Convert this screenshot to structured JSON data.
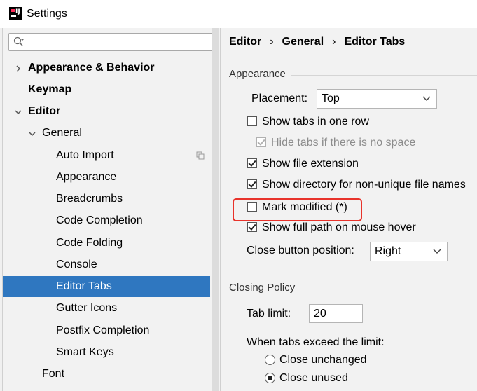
{
  "window": {
    "title": "Settings"
  },
  "search": {
    "placeholder": ""
  },
  "tree": [
    {
      "label": "Appearance & Behavior",
      "bold": true,
      "arrow": "right",
      "selected": false,
      "name": "tree-item-appearance-behavior"
    },
    {
      "label": "Keymap",
      "bold": true,
      "arrow": "",
      "selected": false,
      "name": "tree-item-keymap"
    },
    {
      "label": "Editor",
      "bold": true,
      "arrow": "down",
      "selected": false,
      "name": "tree-item-editor"
    },
    {
      "label": "General",
      "bold": false,
      "arrow": "down",
      "selected": false,
      "name": "tree-item-general"
    },
    {
      "label": "Auto Import",
      "bold": false,
      "arrow": "",
      "selected": false,
      "icon": "copy-icon",
      "name": "tree-item-auto-import"
    },
    {
      "label": "Appearance",
      "bold": false,
      "arrow": "",
      "selected": false,
      "name": "tree-item-appearance"
    },
    {
      "label": "Breadcrumbs",
      "bold": false,
      "arrow": "",
      "selected": false,
      "name": "tree-item-breadcrumbs"
    },
    {
      "label": "Code Completion",
      "bold": false,
      "arrow": "",
      "selected": false,
      "name": "tree-item-code-completion"
    },
    {
      "label": "Code Folding",
      "bold": false,
      "arrow": "",
      "selected": false,
      "name": "tree-item-code-folding"
    },
    {
      "label": "Console",
      "bold": false,
      "arrow": "",
      "selected": false,
      "name": "tree-item-console"
    },
    {
      "label": "Editor Tabs",
      "bold": false,
      "arrow": "",
      "selected": true,
      "name": "tree-item-editor-tabs"
    },
    {
      "label": "Gutter Icons",
      "bold": false,
      "arrow": "",
      "selected": false,
      "name": "tree-item-gutter-icons"
    },
    {
      "label": "Postfix Completion",
      "bold": false,
      "arrow": "",
      "selected": false,
      "name": "tree-item-postfix-completion"
    },
    {
      "label": "Smart Keys",
      "bold": false,
      "arrow": "",
      "selected": false,
      "name": "tree-item-smart-keys"
    },
    {
      "label": "Font",
      "bold": false,
      "arrow": "",
      "selected": false,
      "name": "tree-item-font"
    }
  ],
  "breadcrumb": {
    "items": [
      "Editor",
      "General",
      "Editor Tabs"
    ],
    "separator": "›"
  },
  "appearance": {
    "section_title": "Appearance",
    "placement_label": "Placement:",
    "placement_value": "Top",
    "show_tabs_one_row": {
      "label": "Show tabs in one row",
      "checked": false
    },
    "hide_tabs_no_space": {
      "label": "Hide tabs if there is no space",
      "checked": true,
      "disabled": true
    },
    "show_file_extension": {
      "label": "Show file extension",
      "checked": true
    },
    "show_directory": {
      "label": "Show directory for non-unique file names",
      "checked": true
    },
    "mark_modified": {
      "label": "Mark modified (*)",
      "checked": false
    },
    "show_full_path": {
      "label": "Show full path on mouse hover",
      "checked": true
    },
    "close_button_label": "Close button position:",
    "close_button_value": "Right"
  },
  "closing_policy": {
    "section_title": "Closing Policy",
    "tab_limit_label": "Tab limit:",
    "tab_limit_value": "20",
    "exceed_label": "When tabs exceed the limit:",
    "close_unchanged": {
      "label": "Close unchanged",
      "checked": false
    },
    "close_unused": {
      "label": "Close unused",
      "checked": true
    }
  },
  "colors": {
    "selection": "#2f77c0",
    "highlight": "#e8332b",
    "panel": "#f2f2f2"
  }
}
